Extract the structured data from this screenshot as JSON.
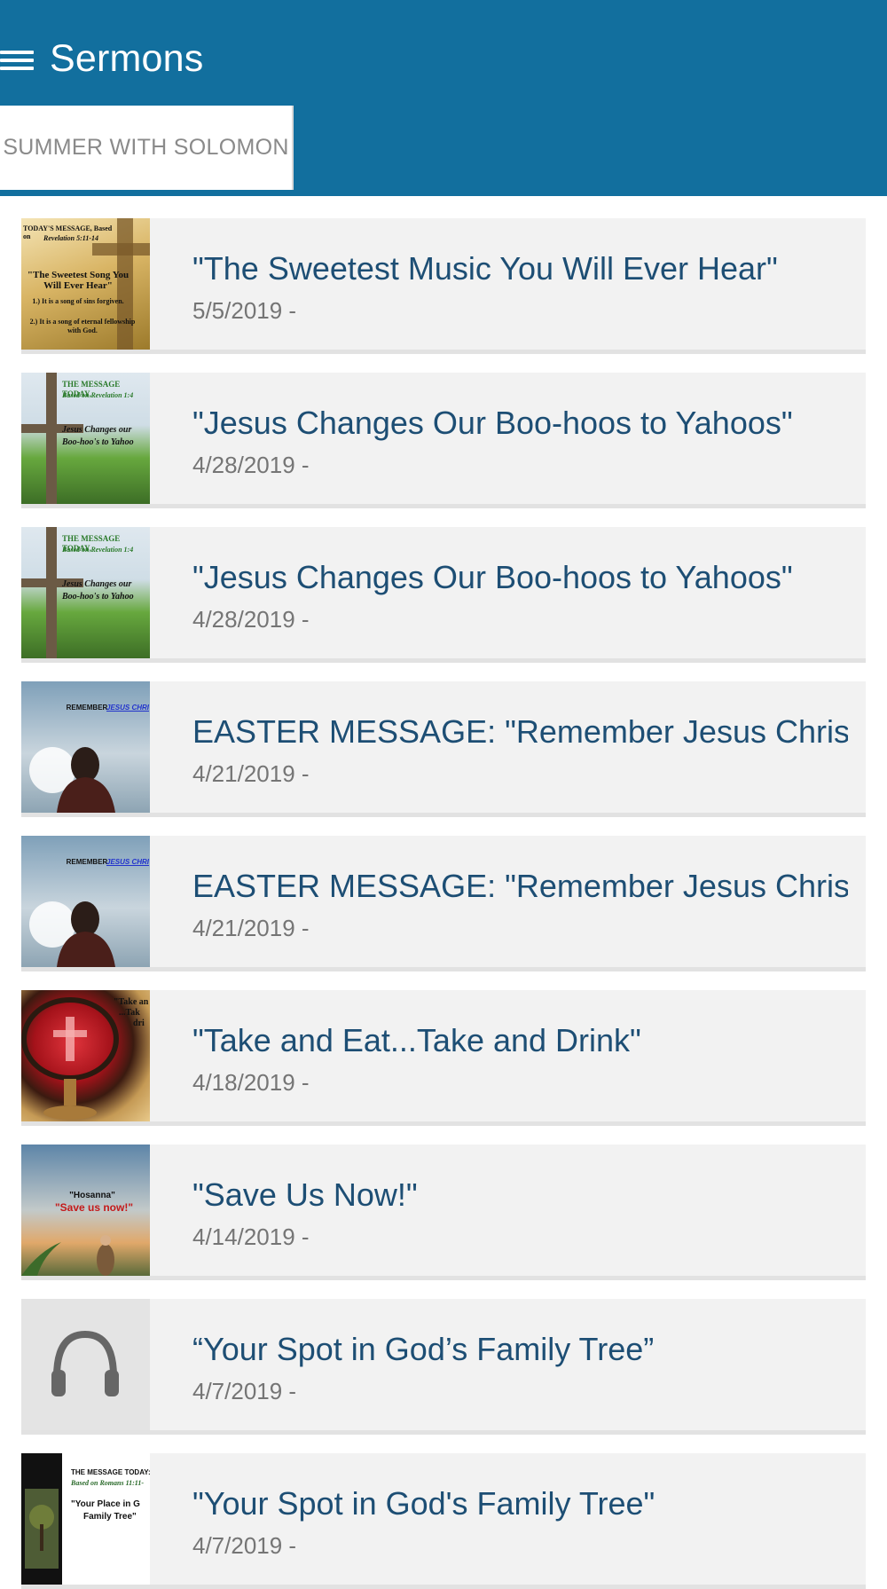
{
  "header": {
    "title": "Sermons",
    "tab_label": "SUMMER WITH SOLOMON",
    "color": "#126f9e"
  },
  "sermons": [
    {
      "title": "\"The Sweetest Music You Will Ever Hear\"",
      "date": "5/5/2019 -",
      "thumb": {
        "line1": "TODAY'S MESSAGE, Based on",
        "line2": "Revelation 5:11-14",
        "line3": "\"The Sweetest Song You Will Ever Hear\"",
        "line4": "1.) It is a song of sins forgiven.",
        "line5": "2.) It is a song of eternal fellowship with God."
      }
    },
    {
      "title": "\"Jesus Changes Our Boo-hoos to Yahoos\"",
      "date": "4/28/2019 -",
      "thumb": {
        "line1": "THE MESSAGE TODAY,",
        "line2": "Based on Revelation 1:4",
        "line3": "Jesus Changes our Boo-hoo's to Yahoo"
      }
    },
    {
      "title": "\"Jesus Changes Our Boo-hoos to Yahoos\"",
      "date": "4/28/2019 -",
      "thumb": {
        "line1": "THE MESSAGE TODAY,",
        "line2": "Based on Revelation 1:4",
        "line3": "Jesus Changes our Boo-hoo's to Yahoo"
      }
    },
    {
      "title": "EASTER MESSAGE: \"Remember Jesus Christ: He",
      "date": "4/21/2019 -",
      "thumb": {
        "line1": "REMEMBER",
        "line2": "JESUS CHRI"
      }
    },
    {
      "title": "EASTER MESSAGE: \"Remember Jesus Christ: He",
      "date": "4/21/2019 -",
      "thumb": {
        "line1": "REMEMBER",
        "line2": "JESUS CHRI"
      }
    },
    {
      "title": "\"Take and Eat...Take and Drink\"",
      "date": "4/18/2019 -",
      "thumb": {
        "line1": "\"Take an",
        "line2": "...Tak",
        "line3": "dri"
      }
    },
    {
      "title": "\"Save Us Now!\"",
      "date": "4/14/2019 -",
      "thumb": {
        "line1": "\"Hosanna\"",
        "line2": "\"Save us now!\""
      }
    },
    {
      "title": "“Your Spot in God’s Family Tree”",
      "date": "4/7/2019 -",
      "thumb": {}
    },
    {
      "title": "\"Your Spot in God's Family Tree\"",
      "date": "4/7/2019 -",
      "thumb": {
        "line1": "THE MESSAGE TODAY:",
        "line2": "Based on Romans 11:11-",
        "line3": "\"Your Place in G",
        "line4": "Family Tree\""
      }
    }
  ]
}
